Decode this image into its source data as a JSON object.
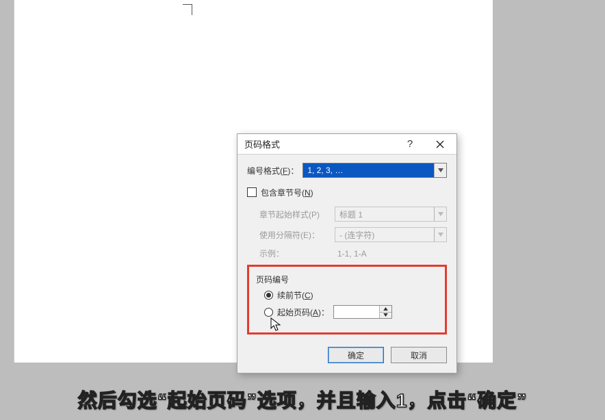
{
  "dialog": {
    "title": "页码格式",
    "format": {
      "label_prefix": "编号格式(",
      "label_hotkey": "F",
      "label_suffix": ")：",
      "selected": "1, 2, 3, …"
    },
    "include_chapter": {
      "label_prefix": "包含章节号(",
      "label_hotkey": "N",
      "label_suffix": ")",
      "checked": false,
      "start_style": {
        "label": "章节起始样式(P)",
        "value": "标题 1"
      },
      "separator": {
        "label": "使用分隔符(E)：",
        "value": "-   (连字符)"
      },
      "example": {
        "label": "示例：",
        "value": "1-1, 1-A"
      }
    },
    "page_number_group": {
      "legend": "页码编号",
      "continue": {
        "label_prefix": "续前节(",
        "label_hotkey": "C",
        "label_suffix": ")",
        "selected": true
      },
      "start_at": {
        "label_prefix": "起始页码(",
        "label_hotkey": "A",
        "label_suffix": ")：",
        "selected": false,
        "value": ""
      }
    },
    "buttons": {
      "ok": "确定",
      "cancel": "取消"
    }
  },
  "subtitle": "然后勾选“起始页码”选项，并且输入1，点击“确定”"
}
